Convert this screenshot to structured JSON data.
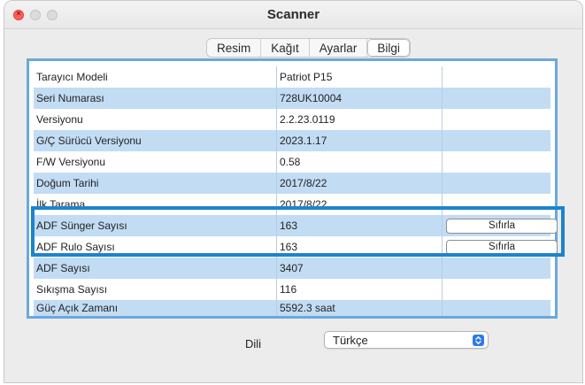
{
  "window": {
    "title": "Scanner"
  },
  "tabs": [
    {
      "label": "Resim"
    },
    {
      "label": "Kağıt"
    },
    {
      "label": "Ayarlar"
    },
    {
      "label": "Bilgi",
      "active": true
    }
  ],
  "table": {
    "rows": [
      {
        "label": "Tarayıcı Modeli",
        "value": "Patriot P15"
      },
      {
        "label": "Seri Numarası",
        "value": "728UK10004"
      },
      {
        "label": "Versiyonu",
        "value": "2.2.23.0119"
      },
      {
        "label": "G/Ç Sürücü Versiyonu",
        "value": "2023.1.17"
      },
      {
        "label": "F/W Versiyonu",
        "value": "0.58"
      },
      {
        "label": "Doğum Tarihi",
        "value": "2017/8/22"
      },
      {
        "label": "İlk Tarama",
        "value": "2017/8/22"
      },
      {
        "label": "ADF Sünger Sayısı",
        "value": "163",
        "button": "Sıfırla"
      },
      {
        "label": "ADF Rulo Sayısı",
        "value": "163",
        "button": "Sıfırla"
      },
      {
        "label": "ADF Sayısı",
        "value": "3407"
      },
      {
        "label": "Sıkışma Sayısı",
        "value": "116"
      },
      {
        "label": "Güç Açık Zamanı",
        "value": "5592.3 saat"
      }
    ]
  },
  "language": {
    "label": "Dili",
    "selected": "Türkçe"
  },
  "icons": {
    "close": "close-icon",
    "minimize": "minimize-icon",
    "zoom": "zoom-icon",
    "select_arrow": "chevron-up-down-icon"
  },
  "colors": {
    "row_blue": "#c2dcf4",
    "panel_border": "#6aa8dd",
    "highlight_border": "#1c84cc",
    "accent": "#2a7bea",
    "close_light": "#fe5f57"
  }
}
